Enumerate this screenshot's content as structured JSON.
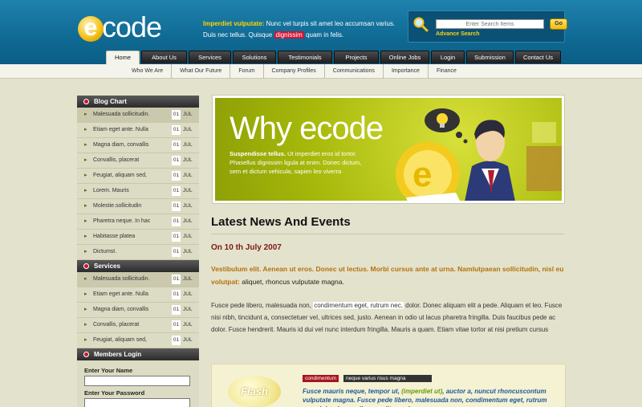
{
  "brand": {
    "logo_e": "e",
    "logo_rest": "code"
  },
  "intro": {
    "highlight": "Imperdiet vulputate:",
    "text1": " Nunc vel turpis sit amet leo accumsan varius. Duis nec tellus. Quisque ",
    "pink": "dignissim",
    "text2": " quam in felis."
  },
  "search": {
    "placeholder": "Enter Search Items",
    "go_label": "Go",
    "advanced_label": "Advance Search"
  },
  "tabs": [
    "Home",
    "About Us",
    "Services",
    "Solutions",
    "Testimonials",
    "Projects",
    "Online Jobs",
    "Login",
    "Submission",
    "Contact Us"
  ],
  "subnav": [
    "Who We Are",
    "What Our Future",
    "Forum",
    "Company Profiles",
    "Communications",
    "Importance",
    "Finance"
  ],
  "sidebar": {
    "blog_title": "Blog Chart",
    "blog_items": [
      {
        "label": "Malesuada sollicitudin.",
        "day": "01",
        "month": "JUL"
      },
      {
        "label": "Etiam eget ante. Nulla",
        "day": "01",
        "month": "JUL"
      },
      {
        "label": "Magna diam, convallis",
        "day": "01",
        "month": "JUL"
      },
      {
        "label": "Convallis, placerat",
        "day": "01",
        "month": "JUL"
      },
      {
        "label": "Feugiat, aliquam sed,",
        "day": "01",
        "month": "JUL"
      },
      {
        "label": "Lorem. Mauris",
        "day": "01",
        "month": "JUL"
      },
      {
        "label": "Molestie.sollicitudin",
        "day": "01",
        "month": "JUL"
      },
      {
        "label": "Pharetra neque. In hac",
        "day": "01",
        "month": "JUL"
      },
      {
        "label": "Habitasse platea",
        "day": "01",
        "month": "JUL"
      },
      {
        "label": "Dictumst.",
        "day": "01",
        "month": "JUL"
      }
    ],
    "services_title": "Services",
    "service_items": [
      {
        "label": "Malesuada sollicitudin.",
        "day": "01",
        "month": "JUL"
      },
      {
        "label": "Etiam eget ante. Nulla",
        "day": "01",
        "month": "JUL"
      },
      {
        "label": "Magna diam, convallis",
        "day": "01",
        "month": "JUL"
      },
      {
        "label": "Convallis, placerat",
        "day": "01",
        "month": "JUL"
      },
      {
        "label": "Feugiat, aliquam sed,",
        "day": "01",
        "month": "JUL"
      }
    ],
    "login_title": "Members Login",
    "name_label": "Enter Your Name",
    "password_label": "Enter Your Password"
  },
  "banner": {
    "title": "Why ecode",
    "bold": "Suspendisse tellus.",
    "text": " Ut imperdiet eros id tortor. Phasellus dignissim ligula at enim. Donec dictum, sem et dictum vehicula, sapien leo viverra"
  },
  "news": {
    "heading": "Latest News And Events",
    "date": "On 10 th July 2007",
    "lead_orange": "Vestibulum elit. Aenean ut eros. Donec ut lectus. Morbi cursus ante at urna. Namlutpaean sollicitudin, nisl eu volutpat:",
    "lead_rest": " aliquet, rhoncus vulputate magna.",
    "para1": "Fusce pede libero, malesuada non, ",
    "para_hl": "condimentum eget, rutrum nec,",
    "para2": " dolor. Donec aliquam elit a pede. Aliquam et leo. Fusce nisi nibh, tincidunt a, consectetuer vel, ultrices sed, justo. Aenean in odio ut lacus pharetra fringilla. Duis faucibus pede ac dolor. Fusce hendrerit. Mauris id dui vel nunc interdum fringilla. Mauris a quam. Etiam vitae tortor at nisi pretium cursus"
  },
  "flash": {
    "cloud_label": "Flash",
    "tag1": "condimentum",
    "tag2": "neque varius risus magna",
    "text1": "Fusce mauris neque, tempor ut, ",
    "text_green": "(imperdiet ut)",
    "text2": ", auctor a, nuncut rhoncuscontum vulputate magna. Fusce pede libero, malesuada non, condimentum eget, rutrum nec, dolor donec aliquam elit a pede."
  },
  "colors": {
    "header_blue": "#0f6a93",
    "accent_red": "#c8162b",
    "date_red": "#7b1a12",
    "lead_orange": "#b5720b",
    "banner_green": "#a6b80a"
  }
}
